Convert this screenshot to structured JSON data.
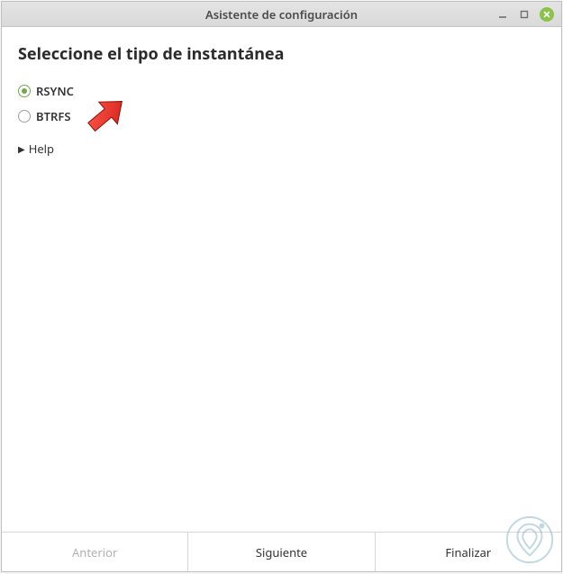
{
  "window": {
    "title": "Asistente de configuración"
  },
  "page": {
    "heading": "Seleccione el tipo de instantánea"
  },
  "options": {
    "rsync": {
      "label": "RSYNC",
      "selected": true
    },
    "btrfs": {
      "label": "BTRFS",
      "selected": false
    }
  },
  "help": {
    "label": "Help"
  },
  "footer": {
    "prev": "Anterior",
    "next": "Siguiente",
    "finish": "Finalizar"
  }
}
